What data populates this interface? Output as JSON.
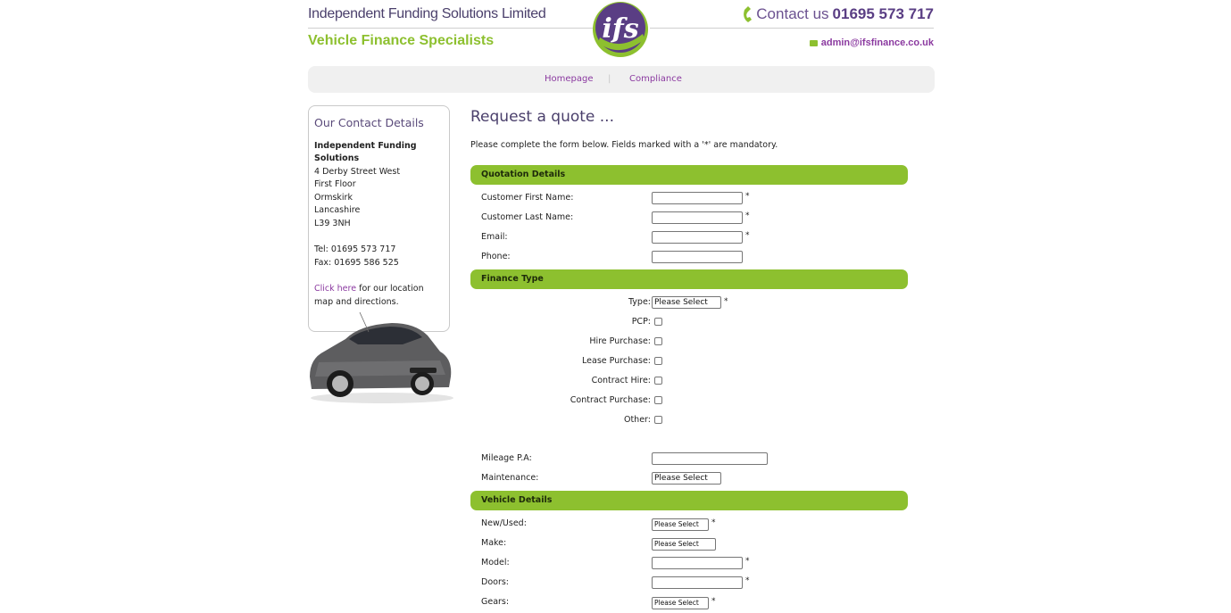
{
  "header": {
    "company_name": "Independent Funding Solutions Limited",
    "tagline": "Vehicle Finance Specialists",
    "logo_text": "ifs",
    "contact_prefix": "Contact us",
    "contact_number": "01695 573 717",
    "email": "admin@ifsfinance.co.uk"
  },
  "nav": {
    "items": [
      "Homepage",
      "Compliance"
    ],
    "separator": "|"
  },
  "sidebar": {
    "title": "Our Contact Details",
    "org_line1": "Independent Funding",
    "org_line2": "Solutions",
    "address": [
      "4 Derby Street West",
      "First Floor",
      "Ormskirk",
      "Lancashire",
      "L39 3NH"
    ],
    "tel": "Tel: 01695 573 717",
    "fax": "Fax: 01695 586 525",
    "click_here": "Click here",
    "map_text1": " for our location",
    "map_text2": "map and directions."
  },
  "main": {
    "title": "Request a quote ...",
    "intro": "Please complete the form below. Fields marked with a '*' are mandatory.",
    "mandatory_marker": "*",
    "sections": {
      "quotation": "Quotation Details",
      "finance": "Finance Type",
      "vehicle": "Vehicle Details"
    },
    "quotation_fields": {
      "first_name": "Customer First Name:",
      "last_name": "Customer Last Name:",
      "email": "Email:",
      "phone": "Phone:"
    },
    "finance_fields": {
      "type": "Type:",
      "type_value": "Please Select",
      "pcp": "PCP:",
      "hire_purchase": "Hire Purchase:",
      "lease_purchase": "Lease Purchase:",
      "contract_hire": "Contract Hire:",
      "contract_purchase": "Contract Purchase:",
      "other": "Other:",
      "mileage": "Mileage P.A:",
      "maintenance": "Maintenance:",
      "maintenance_value": "Please Select"
    },
    "vehicle_fields": {
      "new_used": "New/Used:",
      "new_used_value": "Please Select",
      "make": "Make:",
      "make_value": "Please Select",
      "model": "Model:",
      "doors": "Doors:",
      "gears": "Gears:",
      "gears_value": "Please Select"
    }
  },
  "colors": {
    "brand_green": "#8dc02f",
    "brand_purple": "#5a3e84",
    "link_purple": "#8b3aa0"
  }
}
